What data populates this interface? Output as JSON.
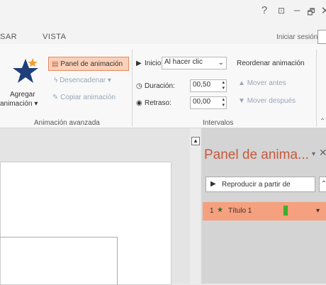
{
  "window": {
    "help": "?",
    "ribbon_options": "⊡",
    "minimize": "–",
    "restore": "🗗",
    "close": "✕"
  },
  "tabs": {
    "items": [
      "SAR",
      "VISTA"
    ]
  },
  "account": {
    "signin": "Iniciar sesión"
  },
  "ribbon": {
    "advanced": {
      "add_animation_line1": "Agregar",
      "add_animation_line2": "animación ▾",
      "animation_pane": "Panel de animación",
      "trigger": "Desencadenar ▾",
      "animation_painter": "Copiar animación",
      "group_label": "Animación avanzada"
    },
    "timing": {
      "start_label": "Inicio:",
      "start_value": "Al hacer clic",
      "duration_label": "Duración:",
      "duration_value": "00,50",
      "delay_label": "Retraso:",
      "delay_value": "00,00",
      "reorder_title": "Reordenar animación",
      "move_earlier": "Mover antes",
      "move_later": "Mover después",
      "group_label": "Intervalos"
    }
  },
  "pane": {
    "title": "Panel de anima...",
    "pin_icon": "▾",
    "close_icon": "✕",
    "play_from": "Reproducir a partir de",
    "item": {
      "number": "1",
      "name": "Título 1",
      "bar_color": "#3fae2a"
    }
  },
  "colors": {
    "accent": "#c55a3d",
    "highlight": "#f5a07e",
    "selected_button": "#fbd0b8"
  }
}
